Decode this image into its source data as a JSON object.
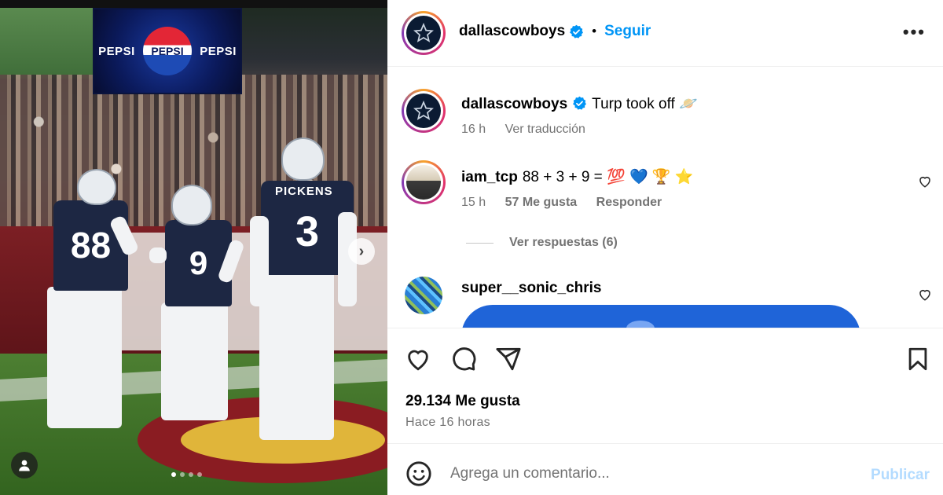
{
  "photo": {
    "billboard": {
      "left_text": "PEPSI",
      "center_text": "PEPSI",
      "right_text": "PEPSI"
    },
    "players": [
      {
        "number": "88"
      },
      {
        "number": "9"
      },
      {
        "name": "PICKENS",
        "number": "3"
      }
    ],
    "carousel": {
      "total": 4,
      "active": 1
    }
  },
  "header": {
    "username": "dallascowboys",
    "separator": "•",
    "follow_label": "Seguir",
    "more_label": "•••"
  },
  "caption": {
    "username": "dallascowboys",
    "text": "Turp took off 🪐",
    "time": "16 h",
    "translate_label": "Ver traducción"
  },
  "comments": [
    {
      "username": "iam_tcp",
      "text": "88 + 3 + 9 = 💯 💙 🏆 ⭐",
      "time": "15 h",
      "likes": "57 Me gusta",
      "reply_label": "Responder",
      "view_replies_label": "Ver respuestas (6)"
    },
    {
      "username": "super__sonic_chris"
    }
  ],
  "actions": {
    "likes_count": "29.134 Me gusta",
    "time_ago": "Hace 16 horas"
  },
  "composer": {
    "placeholder": "Agrega un comentario...",
    "publish_label": "Publicar"
  },
  "colors": {
    "accent": "#0095f6",
    "publish_disabled": "#b3dbff",
    "muted": "#737373",
    "verified": "#0095f6"
  }
}
